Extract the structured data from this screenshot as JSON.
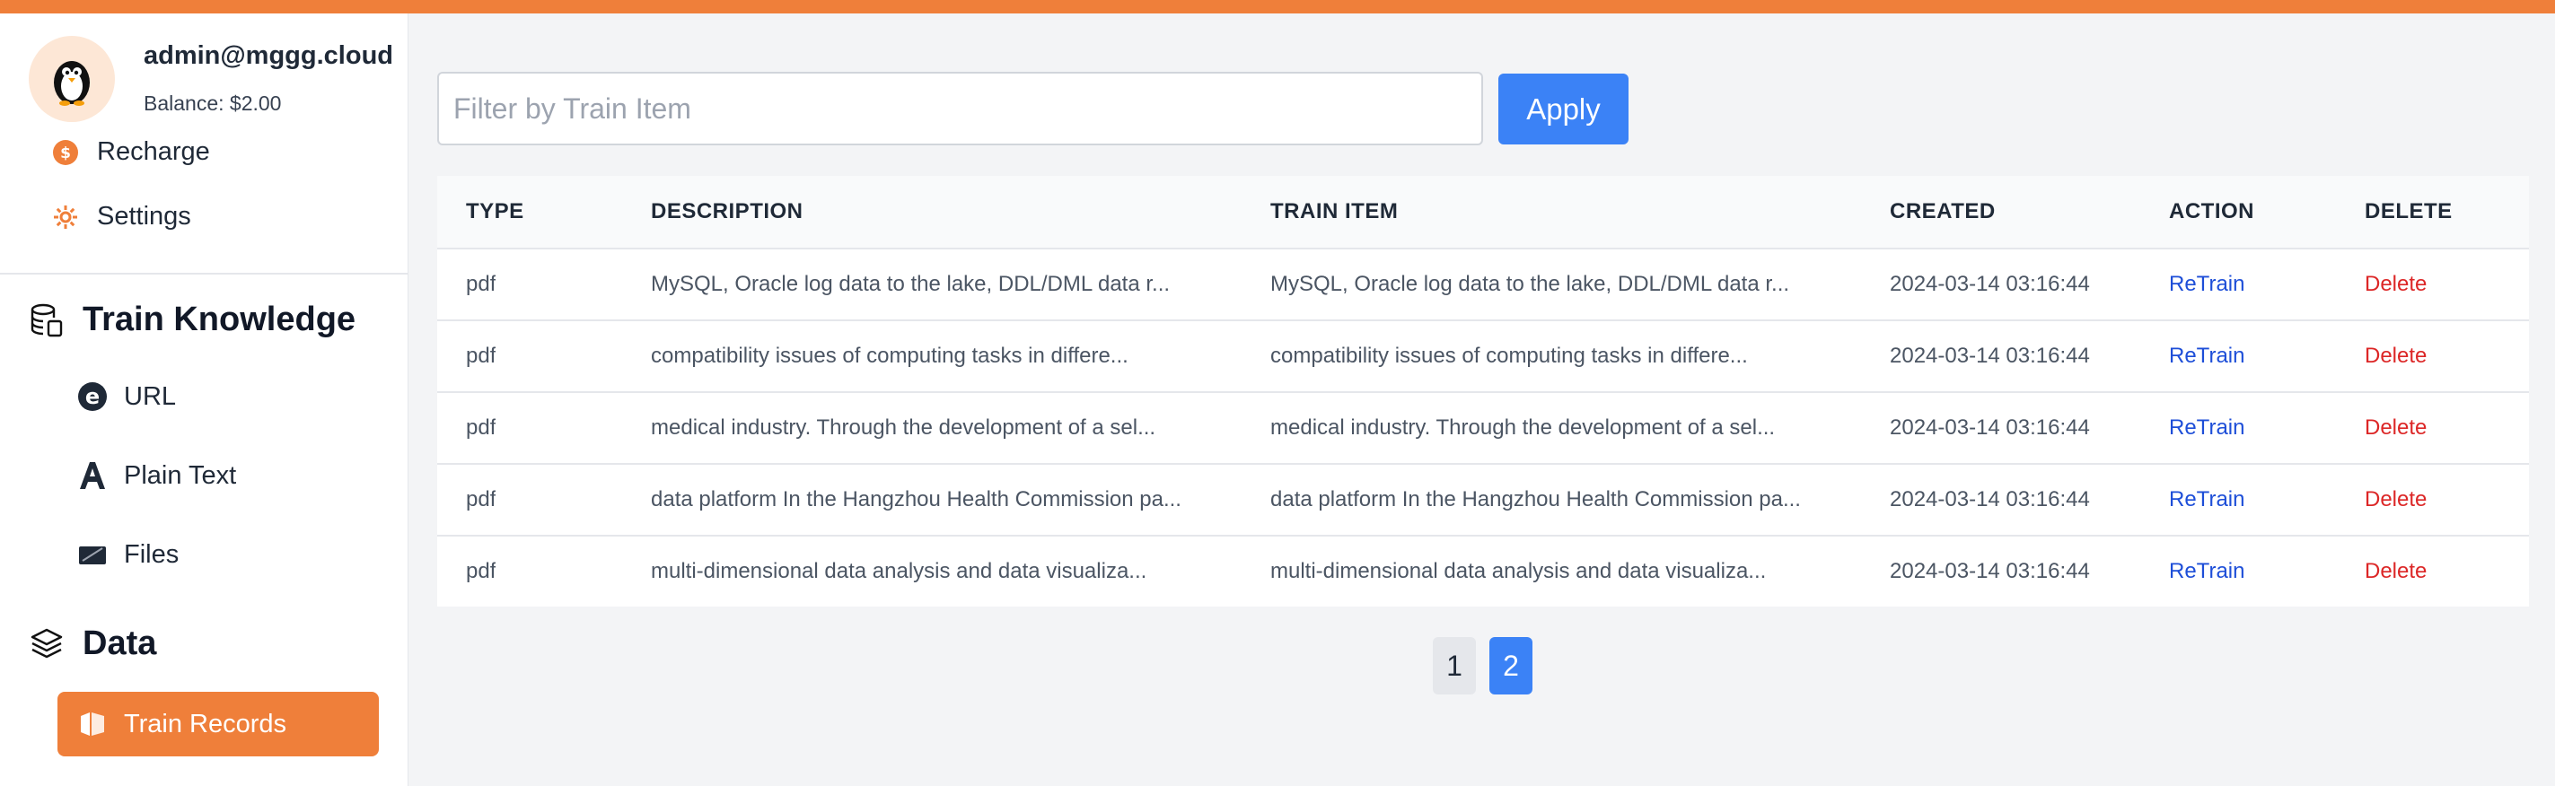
{
  "user": {
    "email": "admin@mggg.cloud",
    "balance": "Balance: $2.00"
  },
  "sidebar": {
    "recharge": "Recharge",
    "settings": "Settings",
    "train_knowledge": {
      "title": "Train Knowledge",
      "items": [
        "URL",
        "Plain Text",
        "Files"
      ]
    },
    "data": {
      "title": "Data",
      "active_item": "Train Records"
    }
  },
  "filter": {
    "placeholder": "Filter by Train Item",
    "value": "",
    "apply_label": "Apply"
  },
  "table": {
    "headers": [
      "TYPE",
      "DESCRIPTION",
      "TRAIN ITEM",
      "CREATED",
      "ACTION",
      "DELETE"
    ],
    "rows": [
      {
        "type": "pdf",
        "description": "MySQL, Oracle log data to the lake, DDL/DML data r...",
        "train_item": "MySQL, Oracle log data to the lake, DDL/DML data r...",
        "created": "2024-03-14 03:16:44",
        "action": "ReTrain",
        "delete": "Delete"
      },
      {
        "type": "pdf",
        "description": "compatibility issues of computing tasks in differe...",
        "train_item": "compatibility issues of computing tasks in differe...",
        "created": "2024-03-14 03:16:44",
        "action": "ReTrain",
        "delete": "Delete"
      },
      {
        "type": "pdf",
        "description": "medical industry. Through the development of a sel...",
        "train_item": "medical industry. Through the development of a sel...",
        "created": "2024-03-14 03:16:44",
        "action": "ReTrain",
        "delete": "Delete"
      },
      {
        "type": "pdf",
        "description": "data platform In the Hangzhou Health Commission pa...",
        "train_item": "data platform In the Hangzhou Health Commission pa...",
        "created": "2024-03-14 03:16:44",
        "action": "ReTrain",
        "delete": "Delete"
      },
      {
        "type": "pdf",
        "description": "multi-dimensional data analysis and data visualiza...",
        "train_item": "multi-dimensional data analysis and data visualiza...",
        "created": "2024-03-14 03:16:44",
        "action": "ReTrain",
        "delete": "Delete"
      }
    ]
  },
  "pagination": {
    "pages": [
      "1",
      "2"
    ],
    "current": "2"
  },
  "colors": {
    "brand": "#ef7f3a",
    "primary": "#3b82f6",
    "link": "#1d4ed8",
    "danger": "#dc2626"
  },
  "icons": {
    "avatar": "penguin-avatar",
    "recharge": "dollar-coin-icon",
    "settings": "gear-icon",
    "train_knowledge": "database-icon",
    "url": "e-browser-icon",
    "plain_text": "letter-a-icon",
    "files": "files-icon",
    "data": "layers-icon",
    "train_records": "records-icon"
  }
}
